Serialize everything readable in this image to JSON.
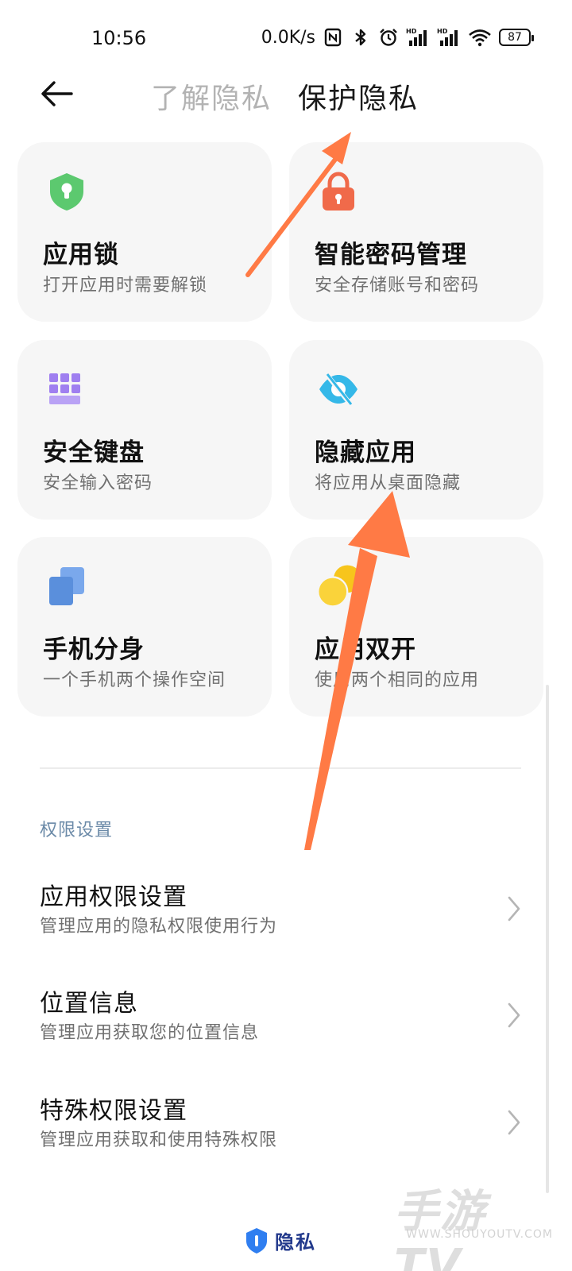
{
  "status_bar": {
    "time": "10:56",
    "network_speed": "0.0K/s",
    "signal_tag_1": "HD",
    "signal_tag_2": "HD",
    "battery": "87"
  },
  "header": {
    "tabs": [
      {
        "label": "了解隐私",
        "active": false
      },
      {
        "label": "保护隐私",
        "active": true
      }
    ]
  },
  "cards": [
    {
      "title": "应用锁",
      "subtitle": "打开应用时需要解锁",
      "icon": "shield-lock-icon",
      "color": "#5cc96f"
    },
    {
      "title": "智能密码管理",
      "subtitle": "安全存储账号和密码",
      "icon": "padlock-icon",
      "color": "#f06a4a"
    },
    {
      "title": "安全键盘",
      "subtitle": "安全输入密码",
      "icon": "keyboard-icon",
      "color": "#9f7ff0"
    },
    {
      "title": "隐藏应用",
      "subtitle": "将应用从桌面隐藏",
      "icon": "eye-slash-icon",
      "color": "#35b8e8"
    },
    {
      "title": "手机分身",
      "subtitle": "一个手机两个操作空间",
      "icon": "dual-space-icon",
      "color": "#5a8fdc"
    },
    {
      "title": "应用双开",
      "subtitle": "使用两个相同的应用",
      "icon": "dual-app-icon",
      "color": "#f7c51c"
    }
  ],
  "permissions": {
    "section_title": "权限设置",
    "items": [
      {
        "title": "应用权限设置",
        "subtitle": "管理应用的隐私权限使用行为"
      },
      {
        "title": "位置信息",
        "subtitle": "管理应用获取您的位置信息"
      },
      {
        "title": "特殊权限设置",
        "subtitle": "管理应用获取和使用特殊权限"
      }
    ]
  },
  "footer": {
    "label": "隐私"
  },
  "watermark": {
    "brand": "手游TV",
    "url": "WWW.SHOUYOUTV.COM"
  },
  "annotation_color": "#ff7a45"
}
